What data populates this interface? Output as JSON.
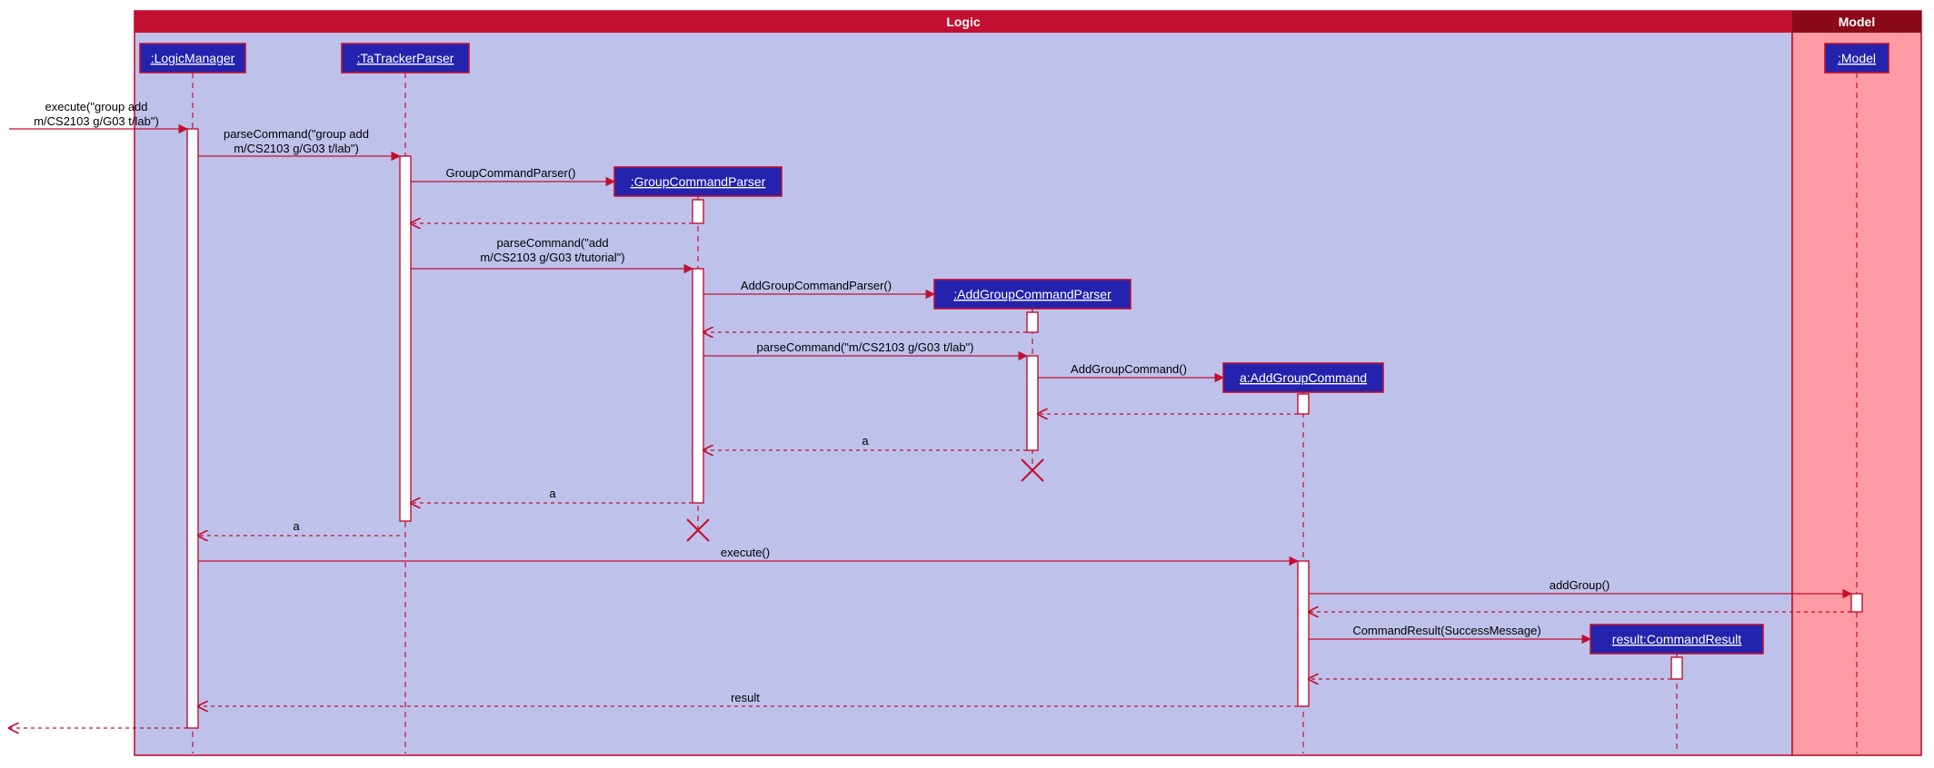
{
  "frames": {
    "logic": "Logic",
    "model": "Model"
  },
  "participants": {
    "logicManager": ":LogicManager",
    "taTrackerParser": ":TaTrackerParser",
    "groupCommandParser": ":GroupCommandParser",
    "addGroupCommandParser": ":AddGroupCommandParser",
    "addGroupCommand": "a:AddGroupCommand",
    "commandResult": "result:CommandResult",
    "model": ":Model"
  },
  "messages": {
    "m1a": "execute(\"group add",
    "m1b": "m/CS2103 g/G03 t/lab\")",
    "m2a": "parseCommand(\"group add",
    "m2b": "m/CS2103 g/G03 t/lab\")",
    "m3": "GroupCommandParser()",
    "m4": "",
    "m5a": "parseCommand(\"add",
    "m5b": "m/CS2103 g/G03 t/tutorial\")",
    "m6": "AddGroupCommandParser()",
    "m7": "",
    "m8": "parseCommand(\"m/CS2103 g/G03 t/lab\")",
    "m9": "AddGroupCommand()",
    "m10": "",
    "m11": "a",
    "m12": "a",
    "m13": "a",
    "m14": "execute()",
    "m15": "addGroup()",
    "m16": "",
    "m17": "CommandResult(SuccessMessage)",
    "m18": "",
    "m19": "result",
    "m20": ""
  }
}
